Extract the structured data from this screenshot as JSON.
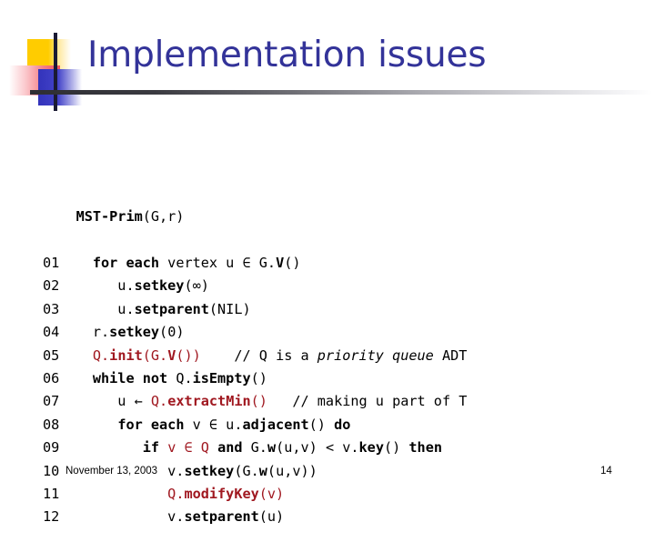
{
  "slide": {
    "title": "Implementation issues",
    "title_color": "#333399",
    "accent_red": "#A01820",
    "logo_yellow": "#FFCC00",
    "logo_red": "#F4525C",
    "logo_blue": "#3333BB",
    "logo_bar": "#1A1A33"
  },
  "code": {
    "signature": {
      "name": "MST-Prim",
      "args": "(G,r)"
    },
    "lines": [
      {
        "num": "01",
        "tokens": [
          {
            "t": "    ",
            "style": "plain"
          },
          {
            "t": "for each",
            "style": "bold"
          },
          {
            "t": " vertex u ",
            "style": "plain"
          },
          {
            "t": "∈",
            "style": "plain"
          },
          {
            "t": " G.",
            "style": "plain"
          },
          {
            "t": "V",
            "style": "bold"
          },
          {
            "t": "()",
            "style": "plain"
          }
        ]
      },
      {
        "num": "02",
        "tokens": [
          {
            "t": "       u.",
            "style": "plain"
          },
          {
            "t": "setkey",
            "style": "bold"
          },
          {
            "t": "(∞)",
            "style": "plain"
          }
        ]
      },
      {
        "num": "03",
        "tokens": [
          {
            "t": "       u.",
            "style": "plain"
          },
          {
            "t": "setparent",
            "style": "bold"
          },
          {
            "t": "(NIL)",
            "style": "plain"
          }
        ]
      },
      {
        "num": "04",
        "tokens": [
          {
            "t": "    r.",
            "style": "plain"
          },
          {
            "t": "setkey",
            "style": "bold"
          },
          {
            "t": "(0)",
            "style": "plain"
          }
        ]
      },
      {
        "num": "05",
        "tokens": [
          {
            "t": "    ",
            "style": "plain"
          },
          {
            "t": "Q.",
            "style": "red"
          },
          {
            "t": "init",
            "style": "red-bold"
          },
          {
            "t": "(G.",
            "style": "red"
          },
          {
            "t": "V",
            "style": "red-bold"
          },
          {
            "t": "())",
            "style": "red"
          },
          {
            "t": "    // Q is a ",
            "style": "plain"
          },
          {
            "t": "priority queue",
            "style": "italic"
          },
          {
            "t": " ADT",
            "style": "plain"
          }
        ]
      },
      {
        "num": "06",
        "tokens": [
          {
            "t": "    ",
            "style": "plain"
          },
          {
            "t": "while not",
            "style": "bold"
          },
          {
            "t": " Q.",
            "style": "plain"
          },
          {
            "t": "isEmpty",
            "style": "bold"
          },
          {
            "t": "()",
            "style": "plain"
          }
        ]
      },
      {
        "num": "07",
        "tokens": [
          {
            "t": "       u ← ",
            "style": "plain"
          },
          {
            "t": "Q.",
            "style": "red"
          },
          {
            "t": "extractMin",
            "style": "red-bold"
          },
          {
            "t": "()",
            "style": "red"
          },
          {
            "t": "   // making u part of T",
            "style": "plain"
          }
        ]
      },
      {
        "num": "08",
        "tokens": [
          {
            "t": "       ",
            "style": "plain"
          },
          {
            "t": "for each",
            "style": "bold"
          },
          {
            "t": " v ∈ u.",
            "style": "plain"
          },
          {
            "t": "adjacent",
            "style": "bold"
          },
          {
            "t": "() ",
            "style": "plain"
          },
          {
            "t": "do",
            "style": "bold"
          }
        ]
      },
      {
        "num": "09",
        "tokens": [
          {
            "t": "          ",
            "style": "plain"
          },
          {
            "t": "if",
            "style": "bold"
          },
          {
            "t": " ",
            "style": "plain"
          },
          {
            "t": "v ∈ Q",
            "style": "red"
          },
          {
            "t": " ",
            "style": "plain"
          },
          {
            "t": "and",
            "style": "bold"
          },
          {
            "t": " G.",
            "style": "plain"
          },
          {
            "t": "w",
            "style": "bold"
          },
          {
            "t": "(u,v) < v.",
            "style": "plain"
          },
          {
            "t": "key",
            "style": "bold"
          },
          {
            "t": "() ",
            "style": "plain"
          },
          {
            "t": "then",
            "style": "bold"
          }
        ]
      },
      {
        "num": "10",
        "tokens": [
          {
            "t": "             v.",
            "style": "plain"
          },
          {
            "t": "setkey",
            "style": "bold"
          },
          {
            "t": "(G.",
            "style": "plain"
          },
          {
            "t": "w",
            "style": "bold"
          },
          {
            "t": "(u,v))",
            "style": "plain"
          }
        ]
      },
      {
        "num": "11",
        "tokens": [
          {
            "t": "             ",
            "style": "plain"
          },
          {
            "t": "Q.",
            "style": "red"
          },
          {
            "t": "modifyKey",
            "style": "red-bold"
          },
          {
            "t": "(v)",
            "style": "red"
          }
        ]
      },
      {
        "num": "12",
        "tokens": [
          {
            "t": "             v.",
            "style": "plain"
          },
          {
            "t": "setparent",
            "style": "bold"
          },
          {
            "t": "(u)",
            "style": "plain"
          }
        ]
      }
    ]
  },
  "footer": {
    "date": "November 13, 2003",
    "page": "14"
  }
}
